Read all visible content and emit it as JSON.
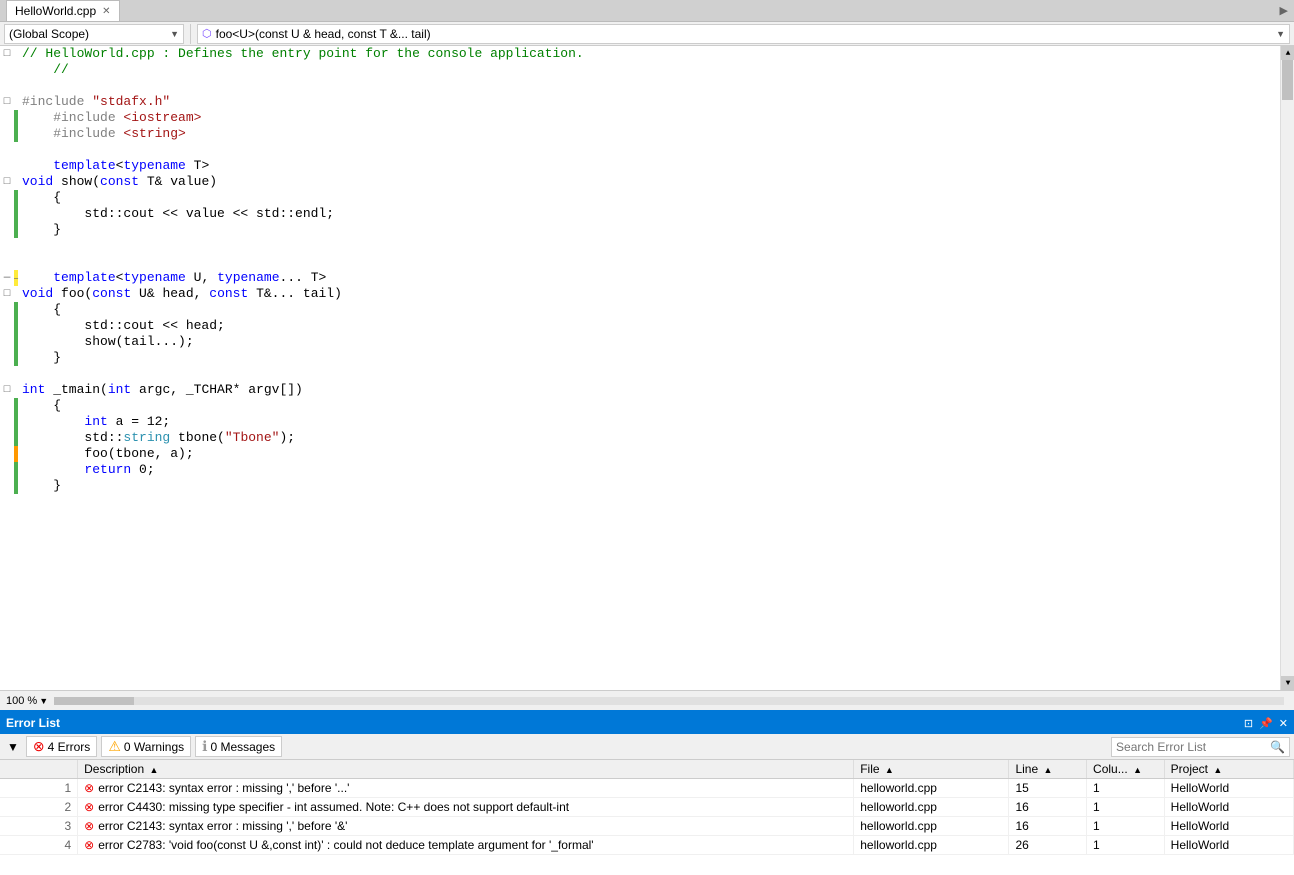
{
  "titleBar": {
    "tab": "HelloWorld.cpp",
    "scrollIcon": "▶"
  },
  "scopeBar": {
    "scope": "(Global Scope)",
    "dropdownArrow": "▼",
    "funcIcon": "⬡",
    "func": "foo<U>(const U & head, const T &... tail)"
  },
  "editor": {
    "lines": [
      {
        "indent": "",
        "text": "// HelloWorld.cpp : Defines the entry point for the console application.",
        "type": "comment",
        "indicator": "none",
        "collapseAt": 1
      },
      {
        "indent": "",
        "text": "//",
        "type": "comment",
        "indicator": "none"
      },
      {
        "indent": "",
        "text": "",
        "type": "plain",
        "indicator": "none"
      },
      {
        "indent": "",
        "text": "#include \"stdafx.h\"",
        "type": "preproc",
        "indicator": "none",
        "collapseAt": 2
      },
      {
        "indent": "    ",
        "text": "#include <iostream>",
        "type": "preproc",
        "indicator": "green"
      },
      {
        "indent": "    ",
        "text": "#include <string>",
        "type": "preproc",
        "indicator": "green"
      },
      {
        "indent": "",
        "text": "",
        "type": "plain",
        "indicator": "none"
      },
      {
        "indent": "    ",
        "text": "template<typename T>",
        "type": "template",
        "indicator": "none"
      },
      {
        "indent": "",
        "text": "void show(const T& value)",
        "type": "plain",
        "indicator": "none",
        "collapseAt": 3
      },
      {
        "indent": "    ",
        "text": "{",
        "type": "plain",
        "indicator": "green"
      },
      {
        "indent": "        ",
        "text": "std::cout << value << std::endl;",
        "type": "plain",
        "indicator": "green"
      },
      {
        "indent": "    ",
        "text": "}",
        "type": "plain",
        "indicator": "green"
      },
      {
        "indent": "",
        "text": "",
        "type": "plain",
        "indicator": "none"
      },
      {
        "indent": "",
        "text": "",
        "type": "plain",
        "indicator": "none"
      },
      {
        "indent": "    ",
        "text": "template<typename U, typename... T>",
        "type": "template",
        "indicator": "yellow",
        "collapseMarker": "dash"
      },
      {
        "indent": "",
        "text": "void foo(const U& head, const T&... tail)",
        "type": "plain",
        "indicator": "none",
        "collapseAt": 4
      },
      {
        "indent": "    ",
        "text": "{",
        "type": "plain",
        "indicator": "green"
      },
      {
        "indent": "        ",
        "text": "std::cout << head;",
        "type": "plain",
        "indicator": "green"
      },
      {
        "indent": "        ",
        "text": "show(tail...);",
        "type": "plain",
        "indicator": "green"
      },
      {
        "indent": "    ",
        "text": "}",
        "type": "plain",
        "indicator": "green"
      },
      {
        "indent": "",
        "text": "",
        "type": "plain",
        "indicator": "none"
      },
      {
        "indent": "",
        "text": "int _tmain(int argc, _TCHAR* argv[])",
        "type": "plain",
        "indicator": "none",
        "collapseAt": 5
      },
      {
        "indent": "    ",
        "text": "{",
        "type": "plain",
        "indicator": "green"
      },
      {
        "indent": "        ",
        "text": "int a = 12;",
        "type": "plain",
        "indicator": "green"
      },
      {
        "indent": "        ",
        "text": "std::string tbone(\"Tbone\");",
        "type": "plain",
        "indicator": "green"
      },
      {
        "indent": "        ",
        "text": "foo(tbone, a);",
        "type": "plain",
        "indicator": "orange"
      },
      {
        "indent": "        ",
        "text": "return 0;",
        "type": "plain",
        "indicator": "green"
      },
      {
        "indent": "    ",
        "text": "}",
        "type": "plain",
        "indicator": "green"
      }
    ]
  },
  "statusBar": {
    "zoom": "100 %",
    "zoomArrow": "▼"
  },
  "errorPanel": {
    "title": "Error List",
    "pinIcon": "📌",
    "closeIcon": "✕",
    "undockIcon": "⊡",
    "toolbar": {
      "filterLabel": "▼",
      "errorsBtn": "4 Errors",
      "warningsBtn": "0 Warnings",
      "messagesBtn": "0 Messages",
      "searchPlaceholder": "Search Error List",
      "searchIcon": "🔍"
    },
    "tableHeaders": [
      {
        "label": "Description",
        "sortArrow": "▲"
      },
      {
        "label": "File",
        "sortArrow": "▲"
      },
      {
        "label": "Line",
        "sortArrow": "▲"
      },
      {
        "label": "Colu...",
        "sortArrow": "▲"
      },
      {
        "label": "Project",
        "sortArrow": "▲"
      }
    ],
    "errors": [
      {
        "num": "1",
        "icon": "✕",
        "description": "error C2143: syntax error : missing ',' before '...'",
        "file": "helloworld.cpp",
        "line": "15",
        "col": "1",
        "project": "HelloWorld"
      },
      {
        "num": "2",
        "icon": "✕",
        "description": "error C4430: missing type specifier - int assumed. Note: C++ does not support default-int",
        "file": "helloworld.cpp",
        "line": "16",
        "col": "1",
        "project": "HelloWorld"
      },
      {
        "num": "3",
        "icon": "✕",
        "description": "error C2143: syntax error : missing ',' before '&'",
        "file": "helloworld.cpp",
        "line": "16",
        "col": "1",
        "project": "HelloWorld"
      },
      {
        "num": "4",
        "icon": "✕",
        "description": "error C2783: 'void foo(const U &,const int)' : could not deduce template argument for '_formal'",
        "file": "helloworld.cpp",
        "line": "26",
        "col": "1",
        "project": "HelloWorld"
      }
    ]
  }
}
